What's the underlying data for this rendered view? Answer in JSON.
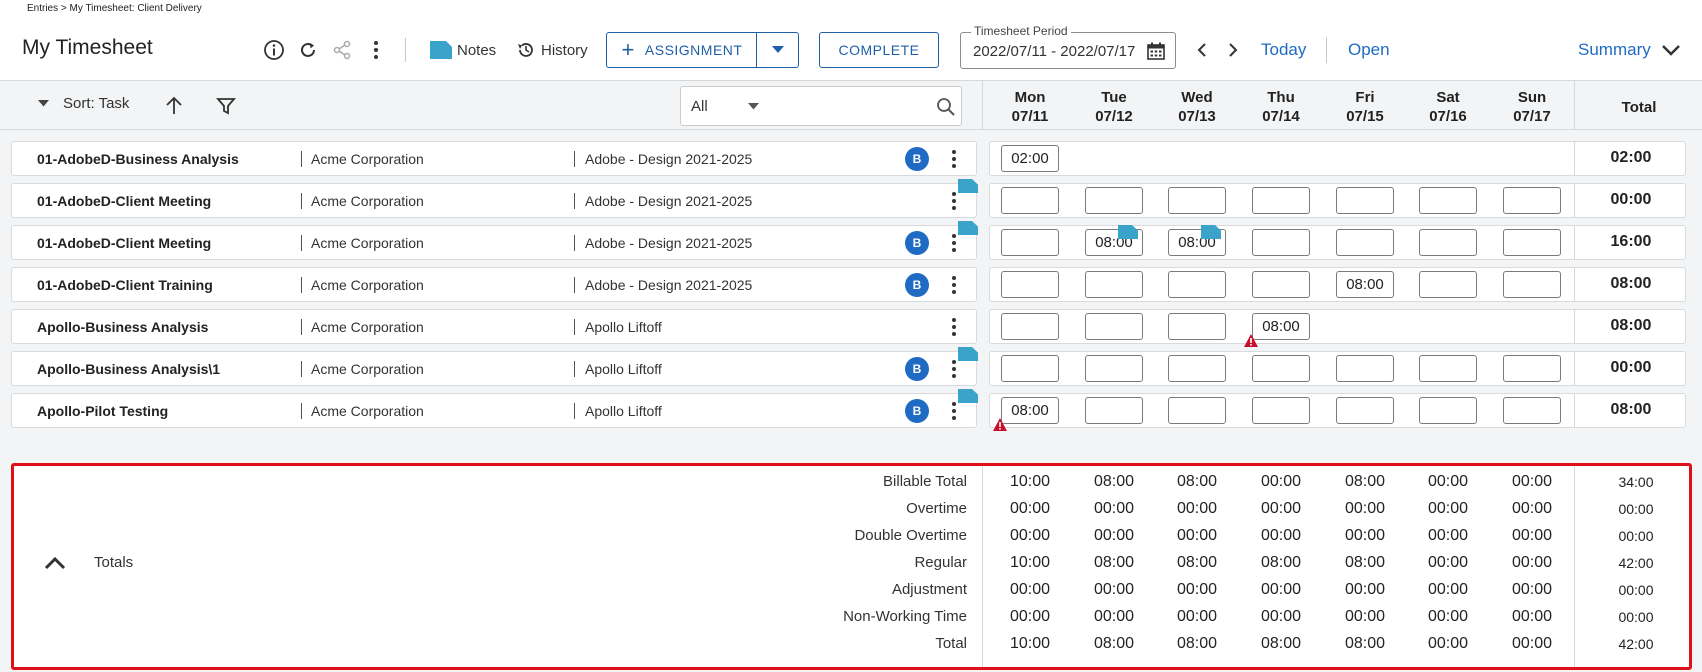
{
  "breadcrumb": "Entries > My Timesheet: Client Delivery",
  "title": "My Timesheet",
  "toolbar": {
    "notes": "Notes",
    "history": "History",
    "assignment": "ASSIGNMENT",
    "complete": "COMPLETE",
    "period_label": "Timesheet Period",
    "period_value": "2022/07/11 - 2022/07/17",
    "today": "Today",
    "open": "Open",
    "summary": "Summary"
  },
  "sortbar": {
    "sort": "Sort: Task",
    "filter_value": "All"
  },
  "days": [
    {
      "dow": "Mon",
      "date": "07/11"
    },
    {
      "dow": "Tue",
      "date": "07/12"
    },
    {
      "dow": "Wed",
      "date": "07/13"
    },
    {
      "dow": "Thu",
      "date": "07/14"
    },
    {
      "dow": "Fri",
      "date": "07/15"
    },
    {
      "dow": "Sat",
      "date": "07/16"
    },
    {
      "dow": "Sun",
      "date": "07/17"
    }
  ],
  "total_header": "Total",
  "rows": [
    {
      "task": "01-AdobeD-Business Analysis",
      "client": "Acme Corporation",
      "project": "Adobe - Design 2021-2025",
      "badge": "B",
      "total": "02:00"
    },
    {
      "task": "01-AdobeD-Client Meeting",
      "client": "Acme Corporation",
      "project": "Adobe - Design 2021-2025",
      "badge": "",
      "total": "00:00"
    },
    {
      "task": "01-AdobeD-Client Meeting",
      "client": "Acme Corporation",
      "project": "Adobe - Design 2021-2025",
      "badge": "B",
      "total": "16:00"
    },
    {
      "task": "01-AdobeD-Client Training",
      "client": "Acme Corporation",
      "project": "Adobe - Design 2021-2025",
      "badge": "B",
      "total": "08:00"
    },
    {
      "task": "Apollo-Business Analysis",
      "client": "Acme Corporation",
      "project": "Apollo Liftoff",
      "badge": "",
      "total": "08:00"
    },
    {
      "task": "Apollo-Business Analysis\\1",
      "client": "Acme Corporation",
      "project": "Apollo Liftoff",
      "badge": "B",
      "total": "00:00"
    },
    {
      "task": "Apollo-Pilot Testing",
      "client": "Acme Corporation",
      "project": "Apollo Liftoff",
      "badge": "B",
      "total": "08:00"
    }
  ],
  "entries": {
    "r0": [
      "02:00"
    ],
    "r1": [
      "",
      "",
      "",
      "",
      "",
      "",
      ""
    ],
    "r2": [
      "",
      "08:00",
      "08:00",
      "",
      "",
      "",
      ""
    ],
    "r3": [
      "",
      "",
      "",
      "",
      "08:00",
      "",
      ""
    ],
    "r4": [
      "",
      "",
      "",
      "08:00"
    ],
    "r5": [
      "",
      "",
      "",
      "",
      "",
      "",
      ""
    ],
    "r6": [
      "08:00",
      "",
      "",
      "",
      "",
      "",
      ""
    ]
  },
  "totals": {
    "label": "Totals",
    "rows": [
      {
        "label": "Billable Total",
        "values": [
          "10:00",
          "08:00",
          "08:00",
          "00:00",
          "08:00",
          "00:00",
          "00:00"
        ],
        "total": "34:00"
      },
      {
        "label": "Overtime",
        "values": [
          "00:00",
          "00:00",
          "00:00",
          "00:00",
          "00:00",
          "00:00",
          "00:00"
        ],
        "total": "00:00"
      },
      {
        "label": "Double Overtime",
        "values": [
          "00:00",
          "00:00",
          "00:00",
          "00:00",
          "00:00",
          "00:00",
          "00:00"
        ],
        "total": "00:00"
      },
      {
        "label": "Regular",
        "values": [
          "10:00",
          "08:00",
          "08:00",
          "08:00",
          "08:00",
          "00:00",
          "00:00"
        ],
        "total": "42:00"
      },
      {
        "label": "Adjustment",
        "values": [
          "00:00",
          "00:00",
          "00:00",
          "00:00",
          "00:00",
          "00:00",
          "00:00"
        ],
        "total": "00:00"
      },
      {
        "label": "Non-Working Time",
        "values": [
          "00:00",
          "00:00",
          "00:00",
          "00:00",
          "00:00",
          "00:00",
          "00:00"
        ],
        "total": "00:00"
      },
      {
        "label": "Total",
        "values": [
          "10:00",
          "08:00",
          "08:00",
          "08:00",
          "08:00",
          "00:00",
          "00:00"
        ],
        "total": "42:00"
      }
    ]
  },
  "colors": {
    "accent": "#1f6bc4",
    "highlight_border": "#e0101a",
    "warning": "#c8102e",
    "note_flag": "#3aa3c9"
  }
}
